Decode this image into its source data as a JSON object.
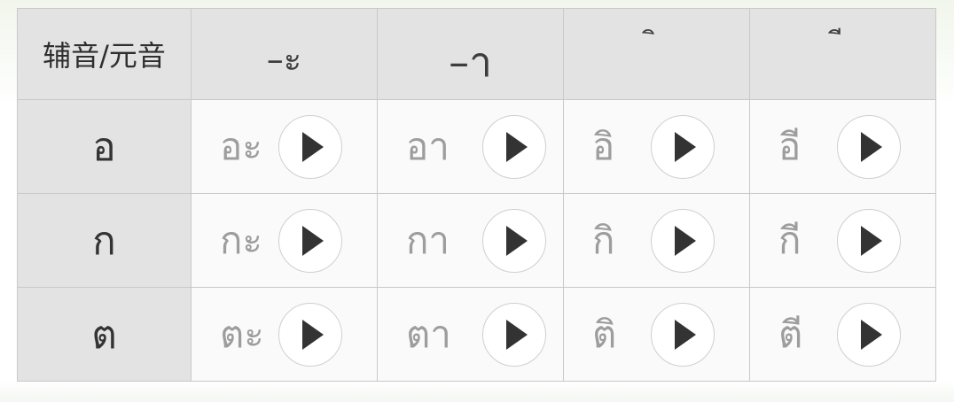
{
  "table": {
    "corner_label": "辅音/元音",
    "vowels": [
      "–ะ",
      "–า",
      "ิ",
      "ี"
    ],
    "rows": [
      {
        "consonant": "อ",
        "cells": [
          "อะ",
          "อา",
          "อิ",
          "อี"
        ]
      },
      {
        "consonant": "ก",
        "cells": [
          "กะ",
          "กา",
          "กิ",
          "กี"
        ]
      },
      {
        "consonant": "ต",
        "cells": [
          "ตะ",
          "ตา",
          "ติ",
          "ตี"
        ]
      }
    ]
  },
  "icons": {
    "play": "play-icon"
  },
  "colors": {
    "header_bg": "#e3e3e3",
    "cell_bg": "#fafafa",
    "border": "#c9c9c9",
    "syllable_text": "#9d9d9d",
    "play_icon": "#333333"
  }
}
